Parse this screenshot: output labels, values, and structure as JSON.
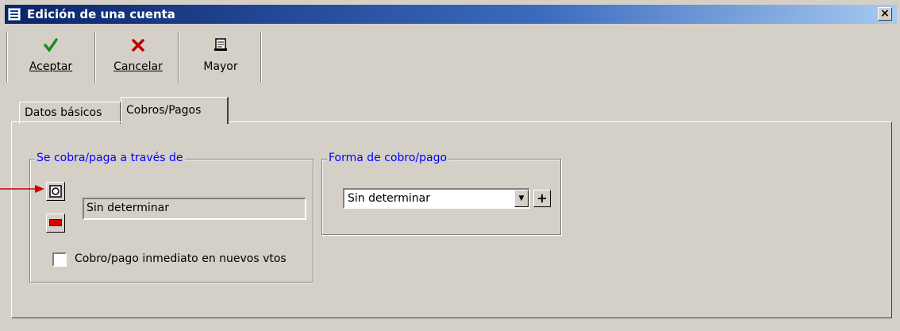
{
  "window": {
    "title": "Edición de una cuenta",
    "close_label": "×"
  },
  "toolbar": {
    "buttons": [
      {
        "label": "Aceptar",
        "icon": "checkmark-icon",
        "color": "#1f8c1f"
      },
      {
        "label": "Cancelar",
        "icon": "x-icon",
        "color": "#c00000"
      },
      {
        "label": "Mayor",
        "icon": "ledger-icon"
      }
    ]
  },
  "tabs": [
    {
      "label": "Datos básicos",
      "active": false
    },
    {
      "label": "Cobros/Pagos",
      "active": true
    }
  ],
  "group_via": {
    "title": "Se cobra/paga a través de",
    "field_value": "Sin determinar",
    "checkbox_label": "Cobro/pago inmediato en nuevos vtos",
    "checkbox_checked": false
  },
  "group_forma": {
    "title": "Forma de cobro/pago",
    "combo_value": "Sin determinar",
    "plus_label": "+"
  },
  "colors": {
    "group_title": "#0000ff",
    "annotation_arrow": "#cc0000",
    "titlebar_start": "#0a246a",
    "titlebar_end": "#a6caf0"
  }
}
